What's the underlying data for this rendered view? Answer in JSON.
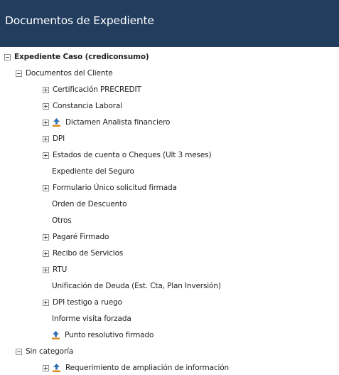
{
  "header": {
    "title": "Documentos de Expediente"
  },
  "colors": {
    "header_bg": "#223d5e",
    "upload_icon": "#e08a1e"
  },
  "tree": {
    "root": {
      "label": "Expediente Caso (crediconsumo)",
      "state": "expanded"
    },
    "documentos_cliente": {
      "label": "Documentos del Cliente",
      "state": "expanded",
      "items": [
        {
          "label": "Certificación PRECREDIT",
          "toggle": "collapsed",
          "upload_icon": false
        },
        {
          "label": "Constancia Laboral",
          "toggle": "collapsed",
          "upload_icon": false
        },
        {
          "label": "Dictamen Analista financiero",
          "toggle": "collapsed",
          "upload_icon": true
        },
        {
          "label": "DPI",
          "toggle": "collapsed",
          "upload_icon": false
        },
        {
          "label": "Estados de cuenta o Cheques (Ult 3 meses)",
          "toggle": "collapsed",
          "upload_icon": false
        },
        {
          "label": "Expediente del Seguro",
          "toggle": "none",
          "upload_icon": false
        },
        {
          "label": "Formulario Único solicitud firmada",
          "toggle": "collapsed",
          "upload_icon": false
        },
        {
          "label": "Orden de Descuento",
          "toggle": "none",
          "upload_icon": false
        },
        {
          "label": "Otros",
          "toggle": "none",
          "upload_icon": false
        },
        {
          "label": "Pagaré Firmado",
          "toggle": "collapsed",
          "upload_icon": false
        },
        {
          "label": "Recibo de Servicios",
          "toggle": "collapsed",
          "upload_icon": false
        },
        {
          "label": "RTU",
          "toggle": "collapsed",
          "upload_icon": false
        },
        {
          "label": "Unificación de Deuda (Est. Cta, Plan Inversión)",
          "toggle": "none",
          "upload_icon": false
        },
        {
          "label": "DPI testigo a ruego",
          "toggle": "collapsed",
          "upload_icon": false
        },
        {
          "label": "Informe visita forzada",
          "toggle": "none",
          "upload_icon": false
        },
        {
          "label": "Punto resolutivo firmado",
          "toggle": "none",
          "upload_icon": true
        }
      ]
    },
    "sin_categoria": {
      "label": "Sin categoría",
      "state": "expanded",
      "items": [
        {
          "label": "Requerimiento de ampliación de información",
          "toggle": "collapsed",
          "upload_icon": true
        }
      ]
    }
  }
}
